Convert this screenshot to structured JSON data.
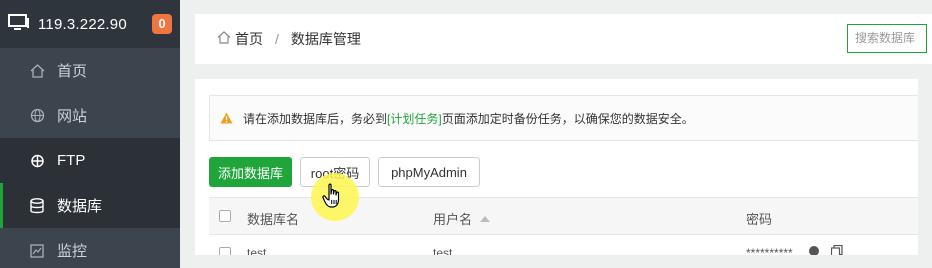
{
  "sidebar": {
    "server_ip": "119.3.222.90",
    "badge_count": "0",
    "items": [
      {
        "label": "首页",
        "icon": "home-icon"
      },
      {
        "label": "网站",
        "icon": "globe-icon"
      },
      {
        "label": "FTP",
        "icon": "ftp-icon"
      },
      {
        "label": "数据库",
        "icon": "database-icon"
      },
      {
        "label": "监控",
        "icon": "monitor-icon"
      }
    ]
  },
  "breadcrumb": {
    "home": "首页",
    "separator": "/",
    "current": "数据库管理"
  },
  "search": {
    "placeholder": "搜索数据库"
  },
  "notice": {
    "before": "请在添加数据库后，务必到",
    "link": "[计划任务]",
    "after": "页面添加定时备份任务，以确保您的数据安全。"
  },
  "toolbar": {
    "add_label": "添加数据库",
    "root_label": "root密码",
    "pma_label": "phpMyAdmin"
  },
  "table": {
    "headers": [
      "数据库名",
      "用户名",
      "密码"
    ],
    "rows": [
      {
        "name": "test",
        "user": "test",
        "password": "**********"
      }
    ]
  },
  "colors": {
    "accent": "#20a53a",
    "sidebar_bg": "#3c444d",
    "badge": "#f0753f"
  }
}
